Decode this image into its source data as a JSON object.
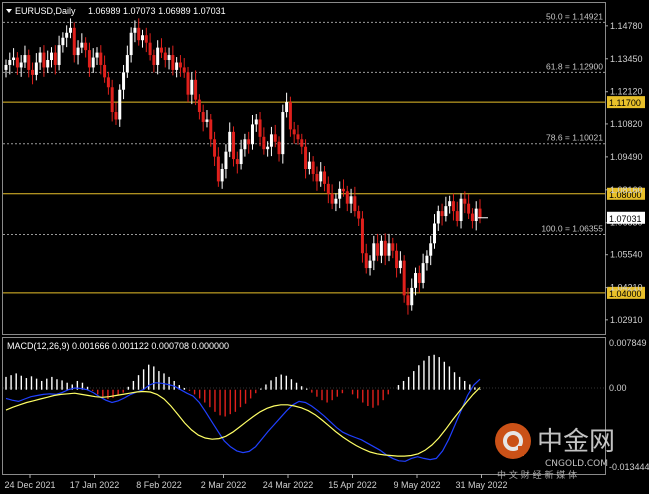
{
  "header": {
    "symbol": "EURUSD,Daily",
    "ohlc": "1.06989 1.07073 1.06989 1.07031"
  },
  "macd": {
    "title": "MACD(12,26,9) 0.001666 0.001122 0.000708 0.000000",
    "scale": {
      "top": "0.007849",
      "zero": "0.00",
      "bottom": "-0.013444"
    }
  },
  "price_axis": {
    "ticks": [
      "1.14780",
      "1.13450",
      "1.12120",
      "1.10820",
      "1.09490",
      "1.08160",
      "1.06830",
      "1.05540",
      "1.04210",
      "1.02910"
    ],
    "current_price": "1.07031"
  },
  "levels": [
    {
      "label": "50.0 = 1.14921",
      "price": 1.14921,
      "kind": "fibo"
    },
    {
      "label": "61.8 = 1.12900",
      "price": 1.129,
      "kind": "fibo"
    },
    {
      "label": "1.11700",
      "price": 1.117,
      "kind": "line"
    },
    {
      "label": "78.6 = 1.10021",
      "price": 1.10021,
      "kind": "fibo"
    },
    {
      "label": "1.08000",
      "price": 1.08,
      "kind": "line"
    },
    {
      "label": "100.0 = 1.06355",
      "price": 1.06355,
      "kind": "fibo"
    },
    {
      "label": "1.04000",
      "price": 1.04,
      "kind": "line"
    }
  ],
  "time_axis": [
    "24 Dec 2021",
    "17 Jan 2022",
    "8 Feb 2022",
    "2 Mar 2022",
    "24 Mar 2022",
    "15 Apr 2022",
    "9 May 2022",
    "31 May 2022"
  ],
  "watermark": {
    "brand": "中金网",
    "domain": "CNGOLD.COM",
    "slogan": "中 文 财 经 新 媒 体"
  },
  "colors": {
    "bull": "#ffffff",
    "bear": "#e0201c",
    "level_line": "#e8c02a",
    "fibo_line": "#9a9a9a",
    "macd_line": "#2040ff",
    "signal_line": "#ffff66"
  },
  "chart_data": {
    "type": "candlestick",
    "ylim": [
      1.025,
      1.155
    ],
    "close": [
      1.132,
      1.134,
      1.135,
      1.131,
      1.133,
      1.136,
      1.13,
      1.128,
      1.133,
      1.137,
      1.131,
      1.134,
      1.137,
      1.132,
      1.14,
      1.143,
      1.145,
      1.147,
      1.136,
      1.139,
      1.141,
      1.138,
      1.131,
      1.135,
      1.137,
      1.132,
      1.127,
      1.123,
      1.113,
      1.11,
      1.122,
      1.129,
      1.136,
      1.145,
      1.147,
      1.142,
      1.144,
      1.141,
      1.136,
      1.132,
      1.139,
      1.137,
      1.134,
      1.136,
      1.13,
      1.133,
      1.131,
      1.129,
      1.12,
      1.126,
      1.118,
      1.113,
      1.109,
      1.11,
      1.102,
      1.095,
      1.085,
      1.09,
      1.097,
      1.105,
      1.094,
      1.092,
      1.098,
      1.102,
      1.1,
      1.108,
      1.11,
      1.103,
      1.098,
      1.099,
      1.104,
      1.101,
      1.096,
      1.113,
      1.117,
      1.106,
      1.104,
      1.102,
      1.099,
      1.09,
      1.093,
      1.088,
      1.085,
      1.089,
      1.084,
      1.08,
      1.076,
      1.078,
      1.082,
      1.081,
      1.076,
      1.079,
      1.073,
      1.07,
      1.056,
      1.05,
      1.053,
      1.06,
      1.055,
      1.061,
      1.055,
      1.06,
      1.057,
      1.05,
      1.053,
      1.039,
      1.035,
      1.042,
      1.048,
      1.044,
      1.052,
      1.055,
      1.06,
      1.068,
      1.073,
      1.071,
      1.075,
      1.077,
      1.073,
      1.069,
      1.078,
      1.076,
      1.072,
      1.069,
      1.074,
      1.07031
    ],
    "macd_hist": [
      0.0022,
      0.0025,
      0.0028,
      0.0024,
      0.002,
      0.0023,
      0.0019,
      0.0015,
      0.0019,
      0.0022,
      0.0018,
      0.0016,
      0.0012,
      0.0009,
      0.0015,
      0.0012,
      0.0005,
      -0.0002,
      -0.0008,
      -0.0012,
      -0.0016,
      -0.0014,
      -0.001,
      -0.0005,
      0.0005,
      0.0015,
      0.0025,
      0.0035,
      0.0043,
      0.004,
      0.0032,
      0.0028,
      0.0022,
      0.0015,
      0.0008,
      0.0003,
      -0.0002,
      -0.0008,
      -0.0015,
      -0.0022,
      -0.003,
      -0.0038,
      -0.0044,
      -0.0046,
      -0.0042,
      -0.0038,
      -0.003,
      -0.0024,
      -0.0015,
      -0.0006,
      0.0002,
      0.0009,
      0.0016,
      0.0022,
      0.0026,
      0.0024,
      0.0018,
      0.0012,
      0.0006,
      0.0002,
      -0.0005,
      -0.0012,
      -0.0018,
      -0.0022,
      -0.0018,
      -0.0012,
      -0.0006,
      0.0,
      -0.0008,
      -0.0015,
      -0.0022,
      -0.0028,
      -0.0031,
      -0.0027,
      -0.0018,
      -0.0008,
      0.0,
      0.0008,
      0.0015,
      0.0022,
      0.0032,
      0.0042,
      0.005,
      0.0058,
      0.006,
      0.0056,
      0.0048,
      0.004,
      0.003,
      0.0022,
      0.0015,
      0.0009,
      0.0004,
      0.0001
    ],
    "macd_line": [
      -0.0015,
      -0.0018,
      -0.002,
      -0.0016,
      -0.0012,
      -0.001,
      -0.0008,
      -0.0007,
      -0.0008,
      -0.0005,
      0.0,
      0.0003,
      0.0002,
      0.0,
      -0.0005,
      -0.0012,
      -0.0018,
      -0.0022,
      -0.0019,
      -0.0014,
      -0.0008,
      -0.0004,
      0.0,
      0.0008,
      0.0012,
      0.0011,
      0.0009,
      0.0006,
      0.0,
      -0.0006,
      -0.0011,
      -0.0022,
      -0.0038,
      -0.0055,
      -0.0072,
      -0.0088,
      -0.0098,
      -0.0105,
      -0.0108,
      -0.0106,
      -0.0098,
      -0.0085,
      -0.0072,
      -0.006,
      -0.0048,
      -0.0036,
      -0.0026,
      -0.002,
      -0.0022,
      -0.0028,
      -0.0036,
      -0.0045,
      -0.0055,
      -0.0065,
      -0.0073,
      -0.0078,
      -0.0082,
      -0.0086,
      -0.0092,
      -0.0098,
      -0.0104,
      -0.0112,
      -0.0118,
      -0.0122,
      -0.0123,
      -0.0118,
      -0.0115,
      -0.0118,
      -0.012,
      -0.0118,
      -0.0105,
      -0.0085,
      -0.006,
      -0.0035,
      -0.001,
      0.0008,
      0.0018
    ],
    "signal_line": [
      -0.0035,
      -0.003,
      -0.0026,
      -0.0022,
      -0.0019,
      -0.0016,
      -0.0013,
      -0.001,
      -0.0008,
      -0.0007,
      -0.0006,
      -0.0008,
      -0.001,
      -0.0012,
      -0.0013,
      -0.0012,
      -0.001,
      -0.0008,
      -0.0006,
      -0.0004,
      -0.0003,
      -0.0004,
      -0.0008,
      -0.0016,
      -0.0028,
      -0.0042,
      -0.0057,
      -0.0069,
      -0.0078,
      -0.0083,
      -0.0085,
      -0.0084,
      -0.008,
      -0.0073,
      -0.0064,
      -0.0055,
      -0.0046,
      -0.0038,
      -0.0032,
      -0.0028,
      -0.0026,
      -0.0026,
      -0.0028,
      -0.0031,
      -0.0036,
      -0.0043,
      -0.0052,
      -0.0062,
      -0.0072,
      -0.0081,
      -0.0089,
      -0.0096,
      -0.0102,
      -0.0107,
      -0.011,
      -0.0112,
      -0.0113,
      -0.0114,
      -0.0114,
      -0.0113,
      -0.011,
      -0.0104,
      -0.0095,
      -0.0083,
      -0.0068,
      -0.0052,
      -0.0037,
      -0.0022,
      -0.0008,
      0.0004
    ]
  }
}
